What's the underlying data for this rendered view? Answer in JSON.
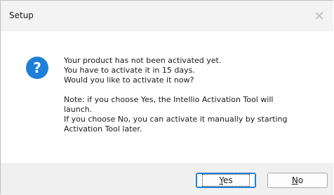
{
  "window": {
    "title": "Setup",
    "close_glyph": "✕",
    "close_icon": "close-icon"
  },
  "message": {
    "icon": "question-icon",
    "icon_glyph": "?",
    "lines_top": [
      "Your product has not been activated yet.",
      "You have to activate it in 15 days.",
      "Would you like to activate it now?"
    ],
    "lines_bottom": [
      "Note: if you choose Yes, the Intellio Activation Tool will",
      "launch.",
      "If you choose No, you can activate it manually by starting",
      "Activation Tool later."
    ]
  },
  "buttons": {
    "yes": {
      "label_first": "Y",
      "label_rest": "es"
    },
    "no": {
      "label_first": "N",
      "label_rest": "o"
    }
  },
  "colors": {
    "accent": "#1f7fd6",
    "footer_bg": "#f0f0f0",
    "content_bg": "#ffffff"
  }
}
